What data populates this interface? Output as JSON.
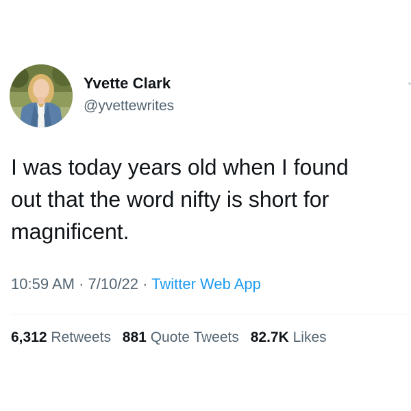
{
  "tweet": {
    "author": {
      "display_name": "Yvette Clark",
      "handle": "@yvettewrites"
    },
    "text": "I was today years old when I found\nout that the word nifty is short for\nmagnificent.",
    "time": "10:59 AM",
    "date": "7/10/22",
    "separator": "·",
    "source": "Twitter Web App",
    "stats": {
      "retweets_count": "6,312",
      "retweets_label": "Retweets",
      "quote_tweets_count": "881",
      "quote_tweets_label": "Quote Tweets",
      "likes_count": "82.7K",
      "likes_label": "Likes"
    }
  },
  "colors": {
    "text_primary": "#0f1419",
    "text_secondary": "#536471",
    "link_blue": "#1d9bf0",
    "divider": "#eff3f4"
  }
}
